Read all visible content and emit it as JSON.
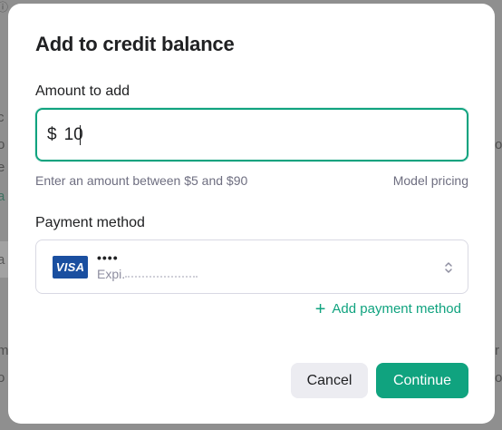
{
  "modal": {
    "title": "Add to credit balance",
    "amount_label": "Amount to add",
    "currency_symbol": "$",
    "amount_value": "10",
    "hint": "Enter an amount between $5 and $90",
    "pricing_link": "Model pricing",
    "payment_label": "Payment method",
    "card": {
      "brand": "VISA",
      "masked_number": "••••",
      "expiry_prefix": "Expi."
    },
    "add_payment_method": "Add payment method",
    "cancel_label": "Cancel",
    "continue_label": "Continue"
  },
  "colors": {
    "accent": "#10a37f",
    "overlay": "#8f8f8f",
    "visa_blue": "#1a4fa0"
  }
}
